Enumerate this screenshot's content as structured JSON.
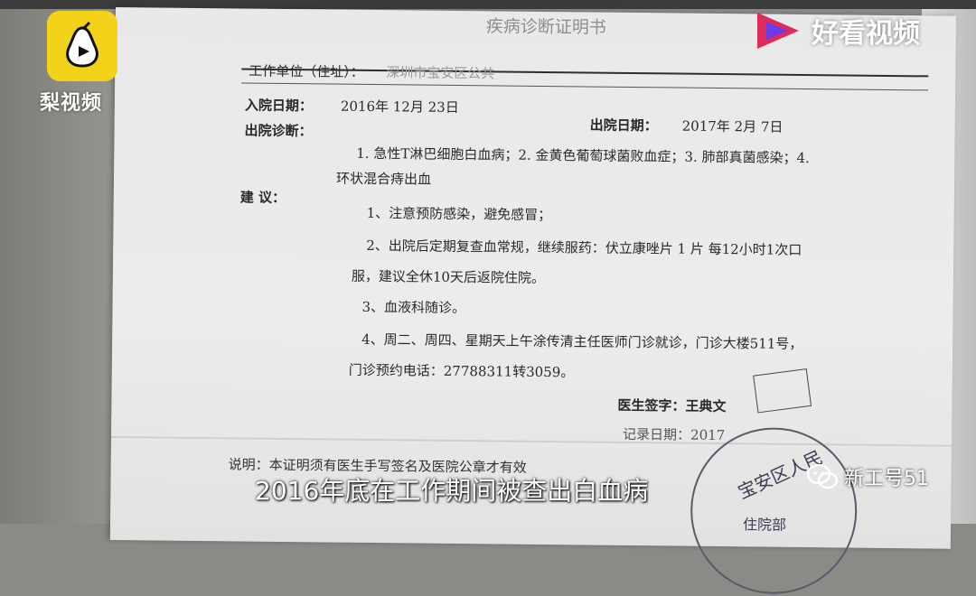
{
  "overlay": {
    "left_logo_text": "梨视频",
    "right_logo_text": "好看视频",
    "subtitle": "2016年底在工作期间被查出白血病",
    "wechat_text": "新工号51"
  },
  "document": {
    "title": "疾病诊断证明书",
    "work_unit_label": "工作单位（住址）：",
    "work_unit_value": "深圳市宝安区公共",
    "admit_label": "入院日期：",
    "admit_value": "2016年    12月    23日",
    "discharge_label": "出院日期：",
    "discharge_value": "2017年  2月    7日",
    "diagnosis_label": "出院诊断：",
    "diagnosis_line1": "1. 急性T淋巴细胞白血病；2. 金黄色葡萄球菌败血症；3. 肺部真菌感染；4.",
    "diagnosis_line2": "环状混合痔出血",
    "advice_label": "建    议：",
    "advice": [
      "1、注意预防感染，避免感冒；",
      "2、出院后定期复查血常规，继续服药：伏立康唑片  1  片  每12小时1次口",
      "服，建议全休10天后返院住院。",
      "3、血液科随诊。",
      "4、周二、周四、星期天上午涂传清主任医师门诊就诊，门诊大楼511号，",
      "门诊预约电话：27788311转3059。"
    ],
    "doctor_sig_label": "医生签字：王典文",
    "record_label": "记录日期：2017",
    "note": "说明：本证明须有医生手写签名及医院公章才有效",
    "stamp_text": "宝安区人民",
    "stamp_bottom": "住院部"
  },
  "colors": {
    "logo_yellow": "#f2d319",
    "brand_red": "#e02a5a",
    "brand_purple": "#6a3de8"
  }
}
